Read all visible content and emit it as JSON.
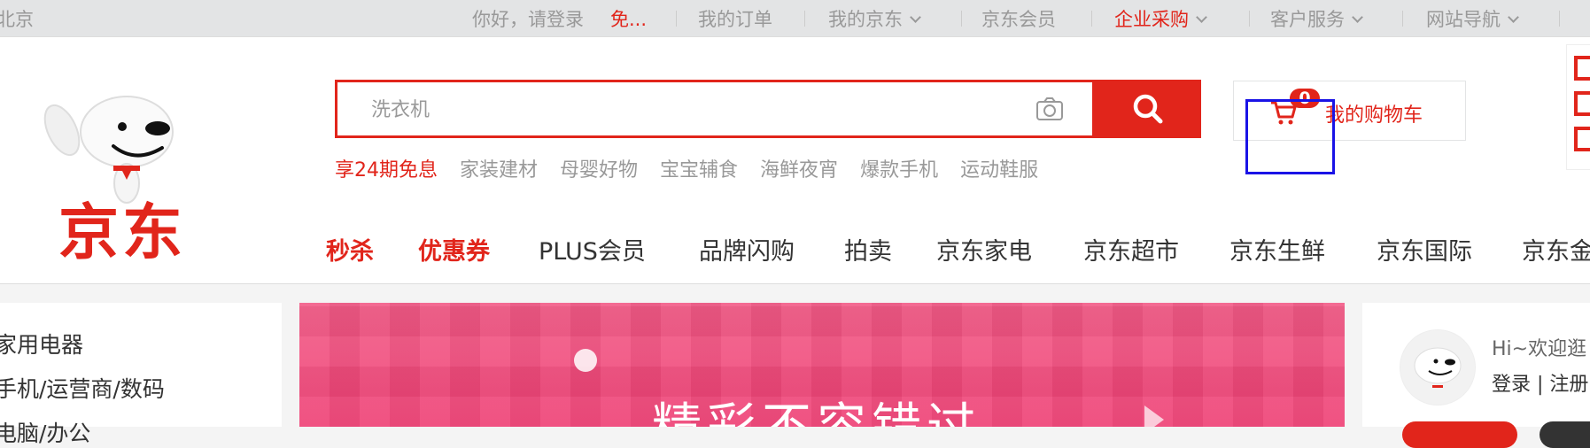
{
  "topbar": {
    "city": "北京",
    "greeting": "你好，请登录",
    "register": "免...",
    "orders": "我的订单",
    "myjd": "我的京东",
    "member": "京东会员",
    "enterprise": "企业采购",
    "service": "客户服务",
    "sitenav": "网站导航"
  },
  "logo": {
    "text": "京东"
  },
  "search": {
    "placeholder": "洗衣机",
    "hotwords": [
      "享24期免息",
      "家装建材",
      "母婴好物",
      "宝宝辅食",
      "海鲜夜宵",
      "爆款手机",
      "运动鞋服"
    ]
  },
  "cart": {
    "count": "0",
    "label": "我的购物车"
  },
  "nav": {
    "items": [
      "秒杀",
      "优惠券",
      "PLUS会员",
      "品牌闪购",
      "拍卖",
      "京东家电",
      "京东超市",
      "京东生鲜",
      "京东国际",
      "京东金"
    ]
  },
  "categories": {
    "items": [
      "家用电器",
      "手机/运营商/数码",
      "电脑/办公"
    ]
  },
  "banner": {
    "text": "精彩不容错过"
  },
  "user": {
    "greeting": "Hi~欢迎逛",
    "links": "登录 | 注册"
  },
  "colors": {
    "accent": "#e1251b",
    "highlight": "#1a13e6"
  }
}
